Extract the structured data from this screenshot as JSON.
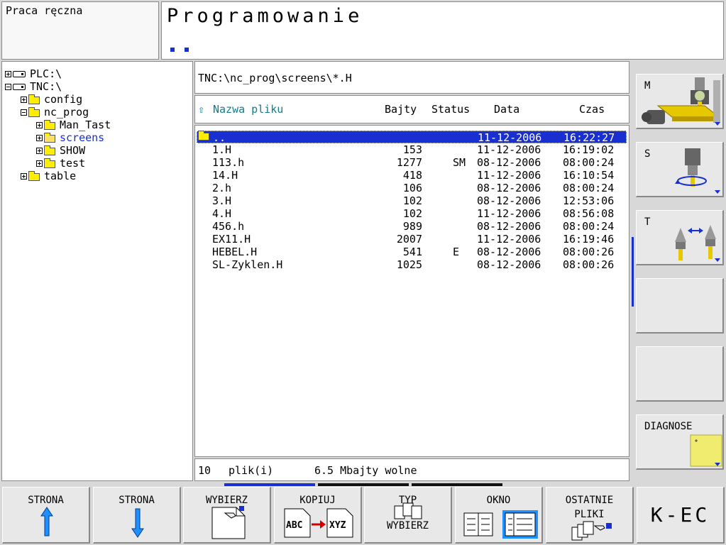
{
  "header": {
    "mode": "Praca ręczna",
    "title": "Programowanie"
  },
  "tree": [
    {
      "label": "PLC:\\",
      "kind": "drive",
      "expander": "plus",
      "level": 0
    },
    {
      "label": "TNC:\\",
      "kind": "drive",
      "expander": "minus",
      "level": 0
    },
    {
      "label": "config",
      "kind": "folder",
      "expander": "plus",
      "level": 1
    },
    {
      "label": "nc_prog",
      "kind": "folder",
      "expander": "minus",
      "level": 1
    },
    {
      "label": "Man_Tast",
      "kind": "folder",
      "expander": "plus",
      "level": 2
    },
    {
      "label": "screens",
      "kind": "folder-open",
      "expander": "plus",
      "level": 2,
      "selected": true
    },
    {
      "label": "SHOW",
      "kind": "folder",
      "expander": "plus",
      "level": 2
    },
    {
      "label": "test",
      "kind": "folder",
      "expander": "plus",
      "level": 2
    },
    {
      "label": "table",
      "kind": "folder",
      "expander": "plus",
      "level": 1
    }
  ],
  "path": "TNC:\\nc_prog\\screens\\*.H",
  "columns": {
    "sort_arrow": "⇧",
    "name": "Nazwa pliku",
    "bytes": "Bajty",
    "status": "Status",
    "date": "Data",
    "time": "Czas"
  },
  "files": [
    {
      "name": "..",
      "bytes": "",
      "status": "",
      "date": "11-12-2006",
      "time": "16:22:27",
      "selected": true,
      "folder": true
    },
    {
      "name": "1.H",
      "bytes": "153",
      "status": "",
      "date": "11-12-2006",
      "time": "16:19:02"
    },
    {
      "name": "113.h",
      "bytes": "1277",
      "status": "SM",
      "date": "08-12-2006",
      "time": "08:00:24"
    },
    {
      "name": "14.H",
      "bytes": "418",
      "status": "",
      "date": "11-12-2006",
      "time": "16:10:54"
    },
    {
      "name": "2.h",
      "bytes": "106",
      "status": "",
      "date": "08-12-2006",
      "time": "08:00:24"
    },
    {
      "name": "3.H",
      "bytes": "102",
      "status": "",
      "date": "08-12-2006",
      "time": "12:53:06"
    },
    {
      "name": "4.H",
      "bytes": "102",
      "status": "",
      "date": "11-12-2006",
      "time": "08:56:08"
    },
    {
      "name": "456.h",
      "bytes": "989",
      "status": "",
      "date": "08-12-2006",
      "time": "08:00:24"
    },
    {
      "name": "EX11.H",
      "bytes": "2007",
      "status": "",
      "date": "11-12-2006",
      "time": "16:19:46"
    },
    {
      "name": "HEBEL.H",
      "bytes": "541",
      "status": "E",
      "date": "08-12-2006",
      "time": "08:00:26"
    },
    {
      "name": "SL-Zyklen.H",
      "bytes": "1025",
      "status": "",
      "date": "08-12-2006",
      "time": "08:00:26"
    }
  ],
  "status_bar": {
    "count": "10",
    "count_label": "plik(i)",
    "free": "6.5 Mbajty wolne"
  },
  "side_keys": [
    {
      "label": "M",
      "icon": "machine-m-icon"
    },
    {
      "label": "S",
      "icon": "spindle-s-icon"
    },
    {
      "label": "T",
      "icon": "tool-t-icon"
    },
    {
      "label": "",
      "icon": ""
    },
    {
      "label": "",
      "icon": ""
    },
    {
      "label": "DIAGNOSE",
      "icon": "diagnose-icon"
    }
  ],
  "bottom_keys": {
    "page_up": "STRONA",
    "page_down": "STRONA",
    "select": "WYBIERZ",
    "copy": "KOPIUJ",
    "copy_from": "ABC",
    "copy_to": "XYZ",
    "type": "TYP\n\nWYBIERZ",
    "window": "OKNO",
    "last_files": "OSTATNIE\nPLIKI",
    "end": "K-EC"
  },
  "colors": {
    "selection": "#1a2fd0",
    "header_text": "#177a8a",
    "folder": "#ffee00",
    "arrow": "#1e90ff"
  }
}
